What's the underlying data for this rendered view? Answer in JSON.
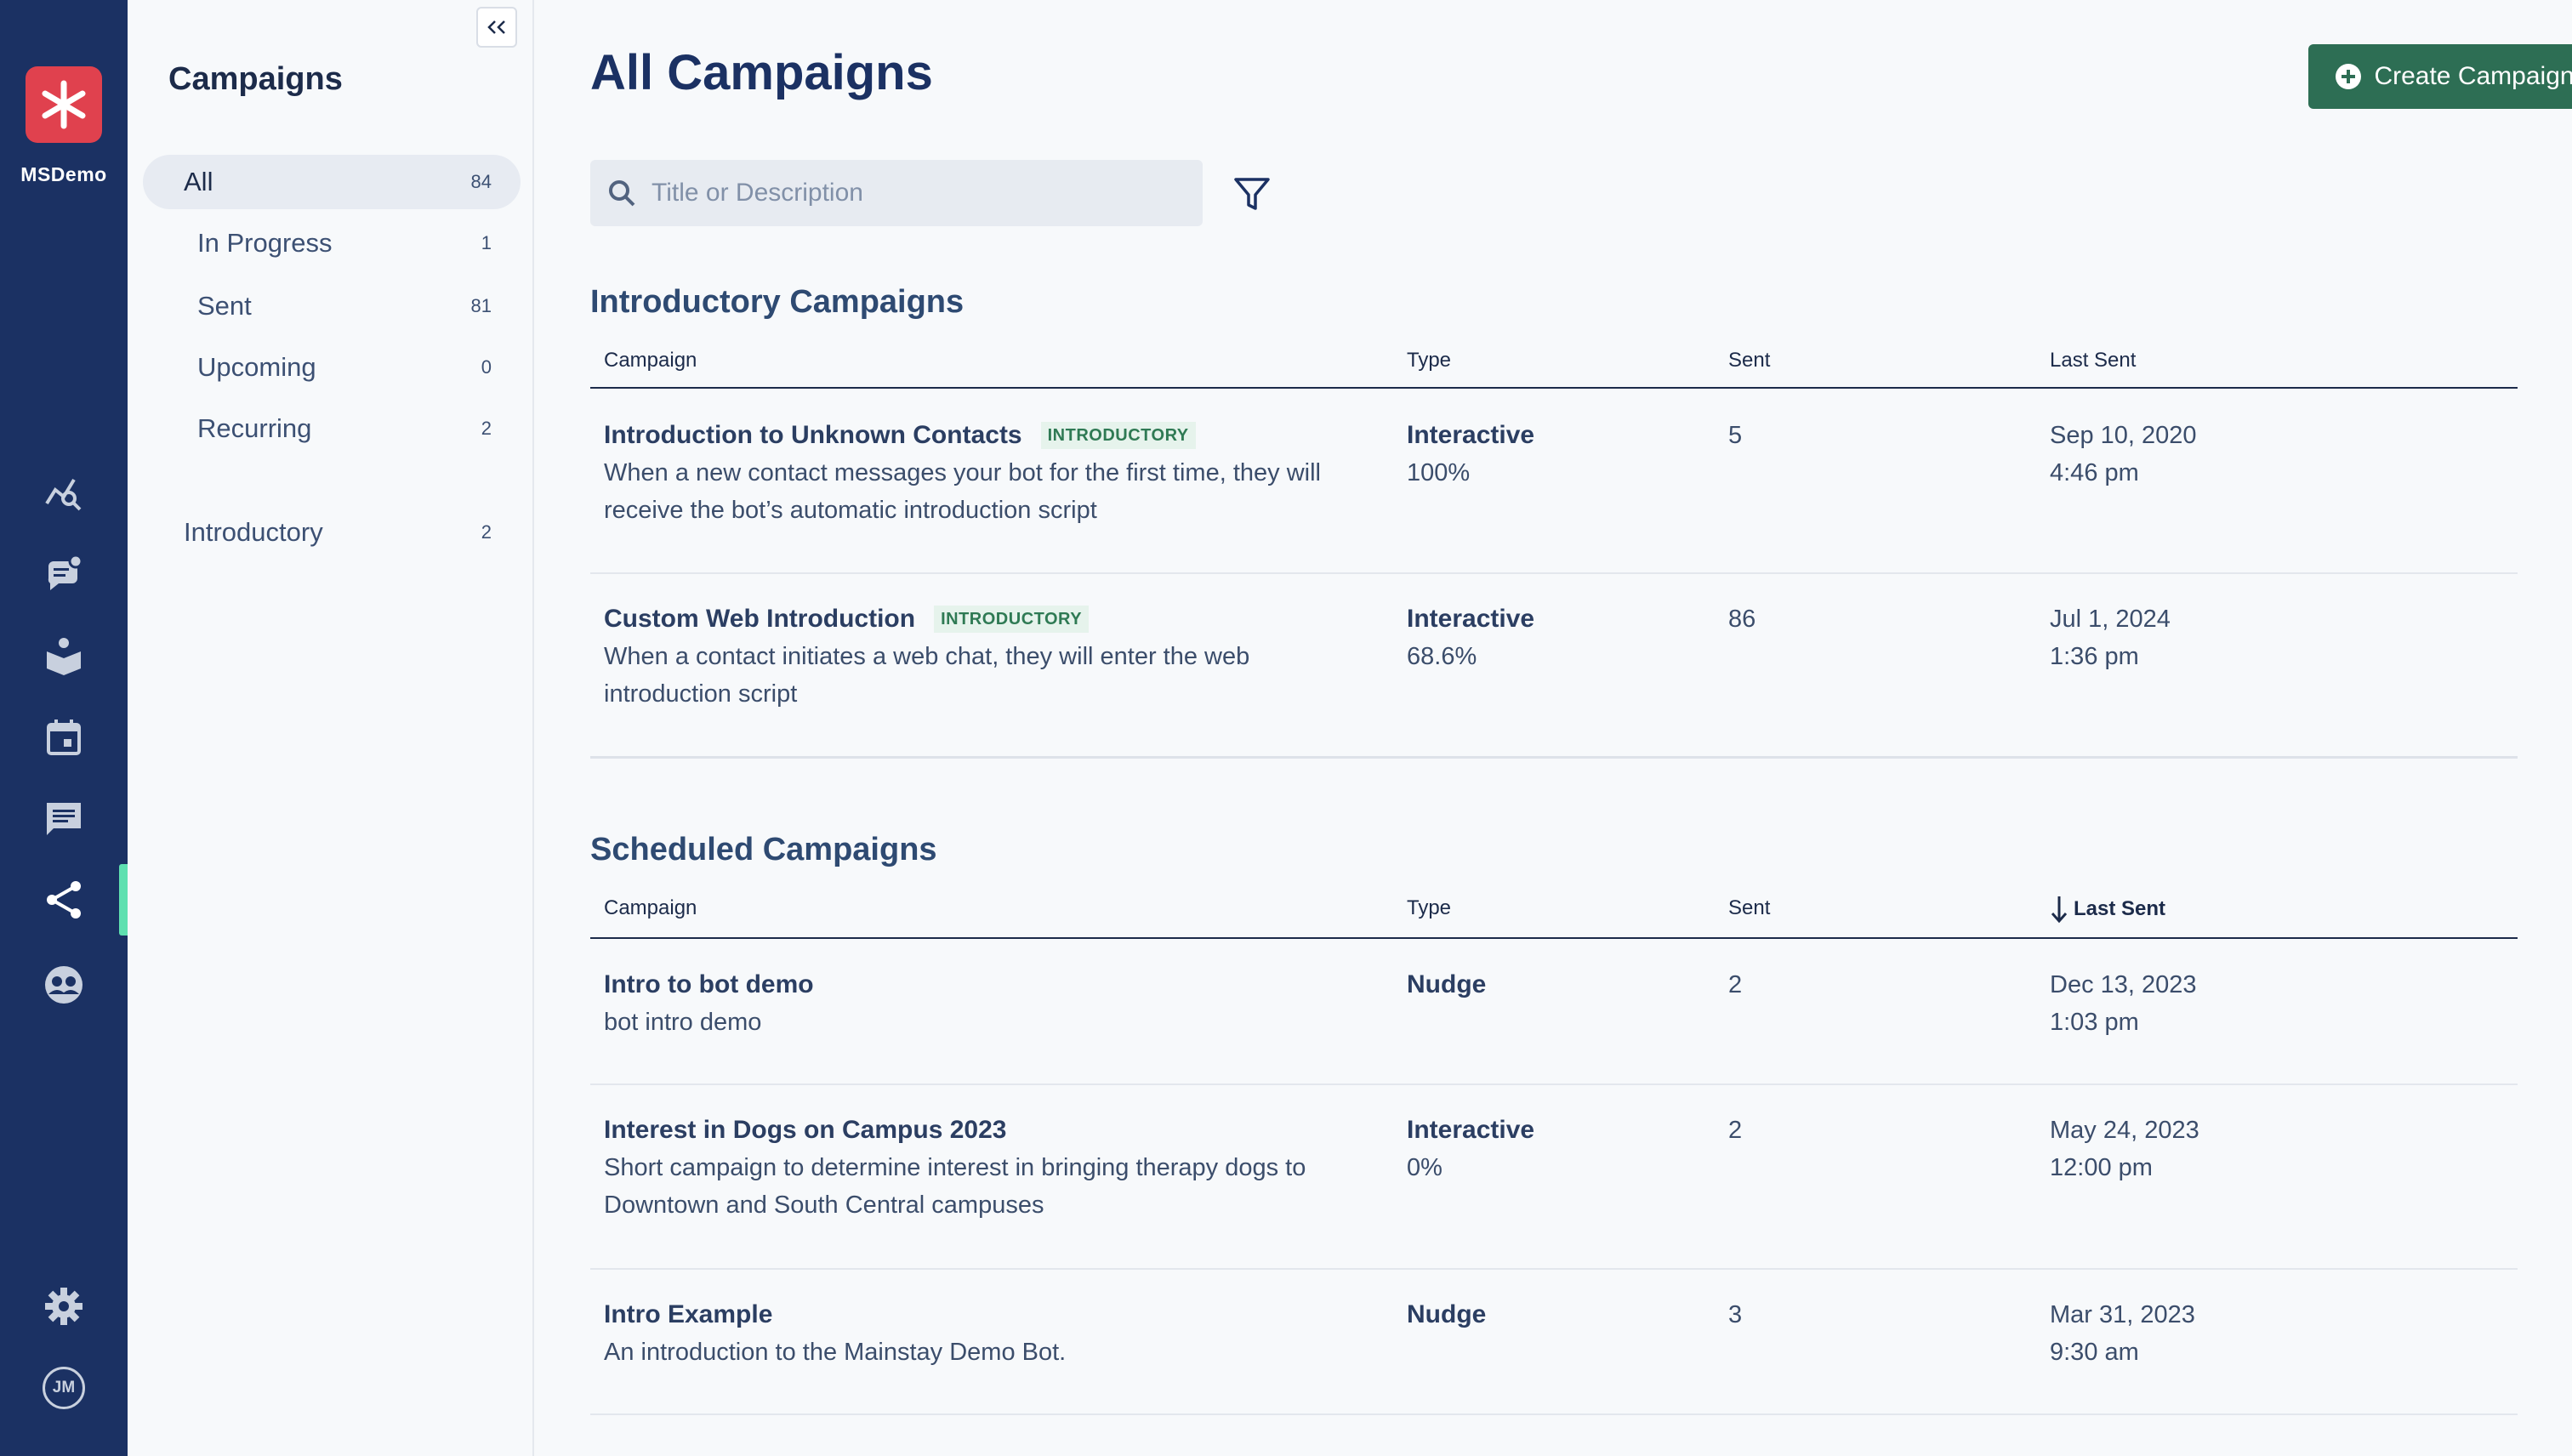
{
  "org": {
    "name": "MSDemo"
  },
  "rail": {
    "icons": [
      "analytics-icon",
      "conversations-icon",
      "knowledge-base-icon",
      "calendar-icon",
      "messages-icon",
      "campaigns-icon",
      "contacts-icon"
    ],
    "active": "campaigns-icon",
    "avatar_initials": "JM"
  },
  "sidebar": {
    "title": "Campaigns",
    "items": [
      {
        "label": "All",
        "count": "84"
      },
      {
        "label": "In Progress",
        "count": "1"
      },
      {
        "label": "Sent",
        "count": "81"
      },
      {
        "label": "Upcoming",
        "count": "0"
      },
      {
        "label": "Recurring",
        "count": "2"
      },
      {
        "label": "Introductory",
        "count": "2"
      }
    ]
  },
  "header": {
    "title": "All Campaigns",
    "create_label": "Create Campaign"
  },
  "search": {
    "placeholder": "Title or Description",
    "value": ""
  },
  "columns": {
    "campaign": "Campaign",
    "type": "Type",
    "sent": "Sent",
    "last_sent": "Last Sent"
  },
  "introductory": {
    "title": "Introductory Campaigns",
    "rows": [
      {
        "name": "Introduction to Unknown Contacts",
        "badge": "INTRODUCTORY",
        "desc1": "When a new contact messages your bot for the first time, they will",
        "desc2": "receive the bot’s automatic introduction script",
        "type": "Interactive",
        "type_sub": "100%",
        "sent": "5",
        "date": "Sep 10, 2020",
        "time": "4:46 pm"
      },
      {
        "name": "Custom Web Introduction",
        "badge": "INTRODUCTORY",
        "desc1": "When a contact initiates a web chat, they will enter the web",
        "desc2": "introduction script",
        "type": "Interactive",
        "type_sub": "68.6%",
        "sent": "86",
        "date": "Jul 1, 2024",
        "time": "1:36 pm"
      }
    ]
  },
  "scheduled": {
    "title": "Scheduled Campaigns",
    "rows": [
      {
        "name": "Intro to bot demo",
        "desc1": "bot intro demo",
        "desc2": "",
        "type": "Nudge",
        "type_sub": "",
        "sent": "2",
        "date": "Dec 13, 2023",
        "time": "1:03 pm"
      },
      {
        "name": "Interest in Dogs on Campus 2023",
        "desc1": "Short campaign to determine interest in bringing therapy dogs to",
        "desc2": "Downtown and South Central campuses",
        "type": "Interactive",
        "type_sub": "0%",
        "sent": "2",
        "date": "May 24, 2023",
        "time": "12:00 pm"
      },
      {
        "name": "Intro Example",
        "desc1": "An introduction to the Mainstay Demo Bot.",
        "desc2": "",
        "type": "Nudge",
        "type_sub": "",
        "sent": "3",
        "date": "Mar 31, 2023",
        "time": "9:30 am"
      }
    ]
  },
  "colors": {
    "rail": "#1b3163",
    "accent": "#2d6e54",
    "logo": "#e0414e",
    "active_indicator": "#5fe0b0"
  }
}
